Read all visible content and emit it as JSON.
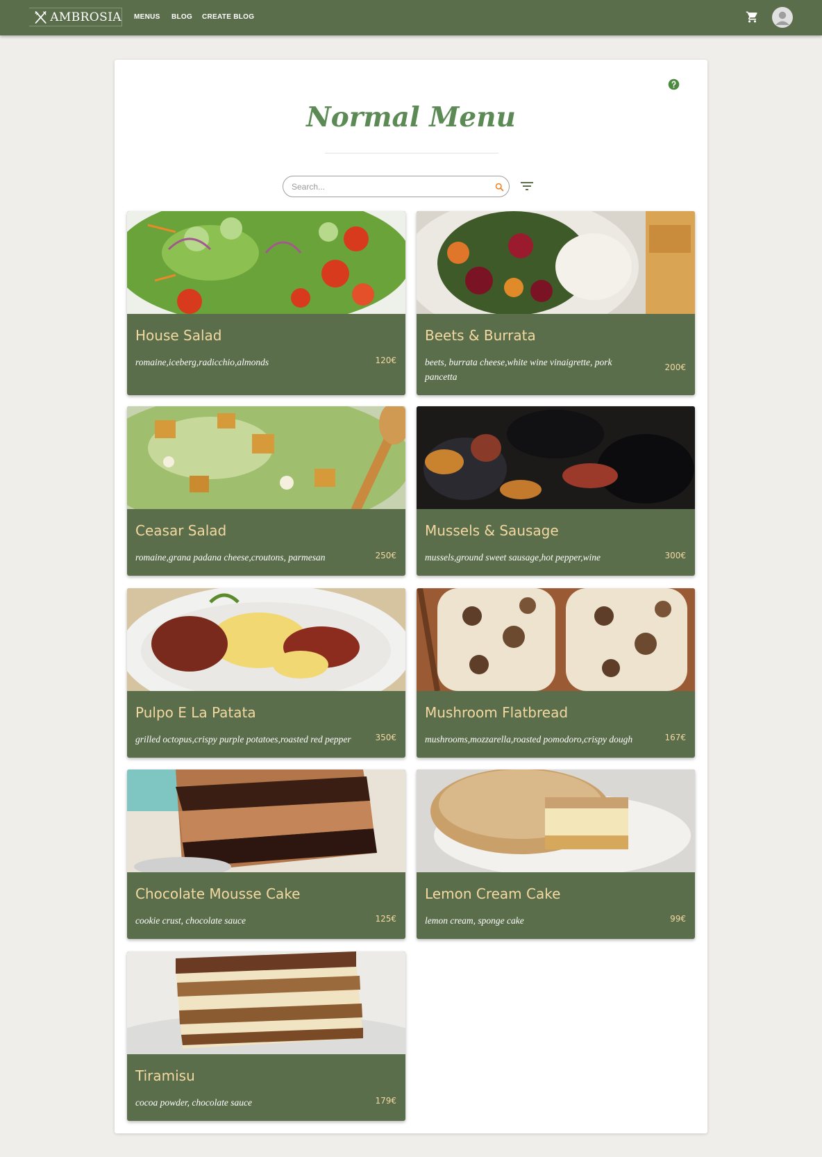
{
  "header": {
    "brand": "AMBROSIA",
    "nav": [
      "MENUS",
      "BLOG",
      "CREATE BLOG"
    ]
  },
  "page": {
    "title": "Normal Menu",
    "search_placeholder": "Search..."
  },
  "colors": {
    "accent": "#5b6e4b",
    "title": "#5b8a55",
    "dish_name": "#f3d9a1",
    "background": "#efeeea"
  },
  "icons": [
    "cutlery-logo-icon",
    "cart-icon",
    "account-icon",
    "help-icon",
    "search-icon",
    "filter-icon"
  ],
  "dishes": [
    {
      "name": "House Salad",
      "description": "romaine,iceberg,radicchio,almonds",
      "price": "120€"
    },
    {
      "name": "Beets & Burrata",
      "description": "beets, burrata cheese,white wine vinaigrette, pork pancetta",
      "price": "200€"
    },
    {
      "name": "Ceasar Salad",
      "description": "romaine,grana padana cheese,croutons, parmesan",
      "price": "250€"
    },
    {
      "name": "Mussels & Sausage",
      "description": "mussels,ground sweet sausage,hot pepper,wine",
      "price": "300€"
    },
    {
      "name": "Pulpo E La Patata",
      "description": "grilled octopus,crispy purple potatoes,roasted red pepper",
      "price": "350€"
    },
    {
      "name": "Mushroom Flatbread",
      "description": "mushrooms,mozzarella,roasted pomodoro,crispy dough",
      "price": "167€"
    },
    {
      "name": "Chocolate Mousse Cake",
      "description": "cookie crust, chocolate sauce",
      "price": "125€"
    },
    {
      "name": "Lemon Cream Cake",
      "description": "lemon cream, sponge cake",
      "price": "99€"
    },
    {
      "name": "Tiramisu",
      "description": "cocoa powder, chocolate sauce",
      "price": "179€"
    }
  ]
}
